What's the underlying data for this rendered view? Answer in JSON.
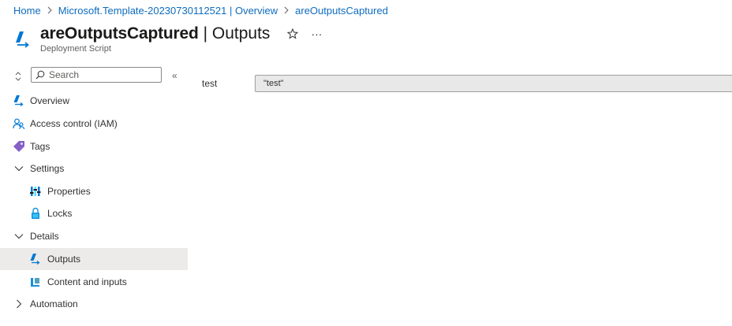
{
  "breadcrumb": {
    "items": [
      {
        "label": "Home"
      },
      {
        "label": "Microsoft.Template-20230730112521 | Overview"
      },
      {
        "label": "areOutputsCaptured"
      }
    ]
  },
  "header": {
    "resource_name": "areOutputsCaptured",
    "section": "Outputs",
    "subtitle": "Deployment Script",
    "more_label": "···",
    "icon": "deployment-script-icon"
  },
  "sidebar": {
    "search": {
      "placeholder": "Search",
      "value": ""
    },
    "collapse_label": "«",
    "items": [
      {
        "label": "Overview",
        "icon": "deployment-script-icon",
        "selected": false
      },
      {
        "label": "Access control (IAM)",
        "icon": "people-icon",
        "selected": false
      },
      {
        "label": "Tags",
        "icon": "tag-icon",
        "selected": false
      },
      {
        "label": "Settings",
        "icon": "chevron-down-icon",
        "group": true,
        "expanded": true
      },
      {
        "label": "Properties",
        "icon": "properties-icon",
        "selected": false
      },
      {
        "label": "Locks",
        "icon": "lock-icon",
        "selected": false
      },
      {
        "label": "Details",
        "icon": "chevron-down-icon",
        "group": true,
        "expanded": true
      },
      {
        "label": "Outputs",
        "icon": "deployment-script-icon",
        "selected": true
      },
      {
        "label": "Content and inputs",
        "icon": "content-icon",
        "selected": false
      },
      {
        "label": "Automation",
        "icon": "chevron-right-icon",
        "group": true,
        "expanded": false
      }
    ]
  },
  "outputs": [
    {
      "key": "test",
      "value": "\"test\""
    }
  ],
  "colors": {
    "link": "#0f6cbd",
    "selected_bg": "#edebe9",
    "azure_blue": "#0078d4",
    "tag_purple": "#8661c5",
    "lock_blue": "#1490df"
  }
}
